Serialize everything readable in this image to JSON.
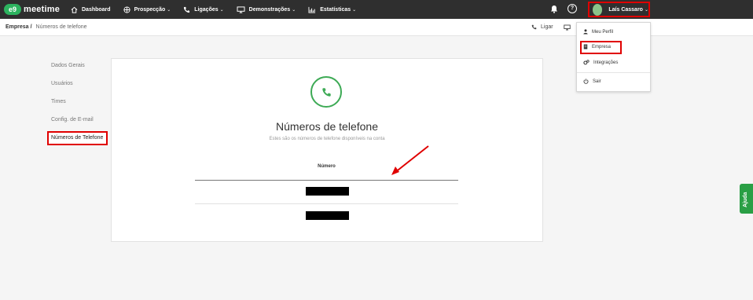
{
  "brand": {
    "logo_mark": "e9",
    "name": "meetime",
    "color": "#2db35f"
  },
  "nav": [
    {
      "label": "Dashboard",
      "icon": "home-icon",
      "has_chevron": false
    },
    {
      "label": "Prospecção",
      "icon": "target-icon",
      "has_chevron": true
    },
    {
      "label": "Ligações",
      "icon": "phone-icon",
      "has_chevron": true
    },
    {
      "label": "Demonstrações",
      "icon": "monitor-icon",
      "has_chevron": true
    },
    {
      "label": "Estatísticas",
      "icon": "chart-icon",
      "has_chevron": true
    }
  ],
  "user": {
    "name": "Laís Cassaro",
    "chevron": "⌄"
  },
  "breadcrumb": {
    "root": "Empresa",
    "separator": "/",
    "current": "Números de telefone"
  },
  "actions": {
    "ligar": "Ligar"
  },
  "sidebar": {
    "items": [
      {
        "label": "Dados Gerais"
      },
      {
        "label": "Usuários"
      },
      {
        "label": "Times"
      },
      {
        "label": "Config. de E-mail"
      },
      {
        "label": "Números de Telefone"
      }
    ],
    "active_index": 4
  },
  "main": {
    "title": "Números de telefone",
    "subtitle": "Estes são os números de telefone disponíveis na conta",
    "table": {
      "columns": [
        "Número"
      ],
      "row_count_redacted": 2
    }
  },
  "dropdown": {
    "items": [
      {
        "label": "Meu Perfil",
        "icon": "user-icon"
      },
      {
        "label": "Empresa",
        "icon": "building-icon"
      },
      {
        "label": "Integrações",
        "icon": "cogs-icon"
      },
      {
        "label": "Sair",
        "icon": "power-icon"
      }
    ],
    "highlighted": "Empresa"
  },
  "help_tab": {
    "label": "Ajuda",
    "color": "#2a9f45"
  },
  "colors": {
    "topbar": "#2f2f2f",
    "accent_green": "#3daa55",
    "highlight_red": "#e00000"
  }
}
